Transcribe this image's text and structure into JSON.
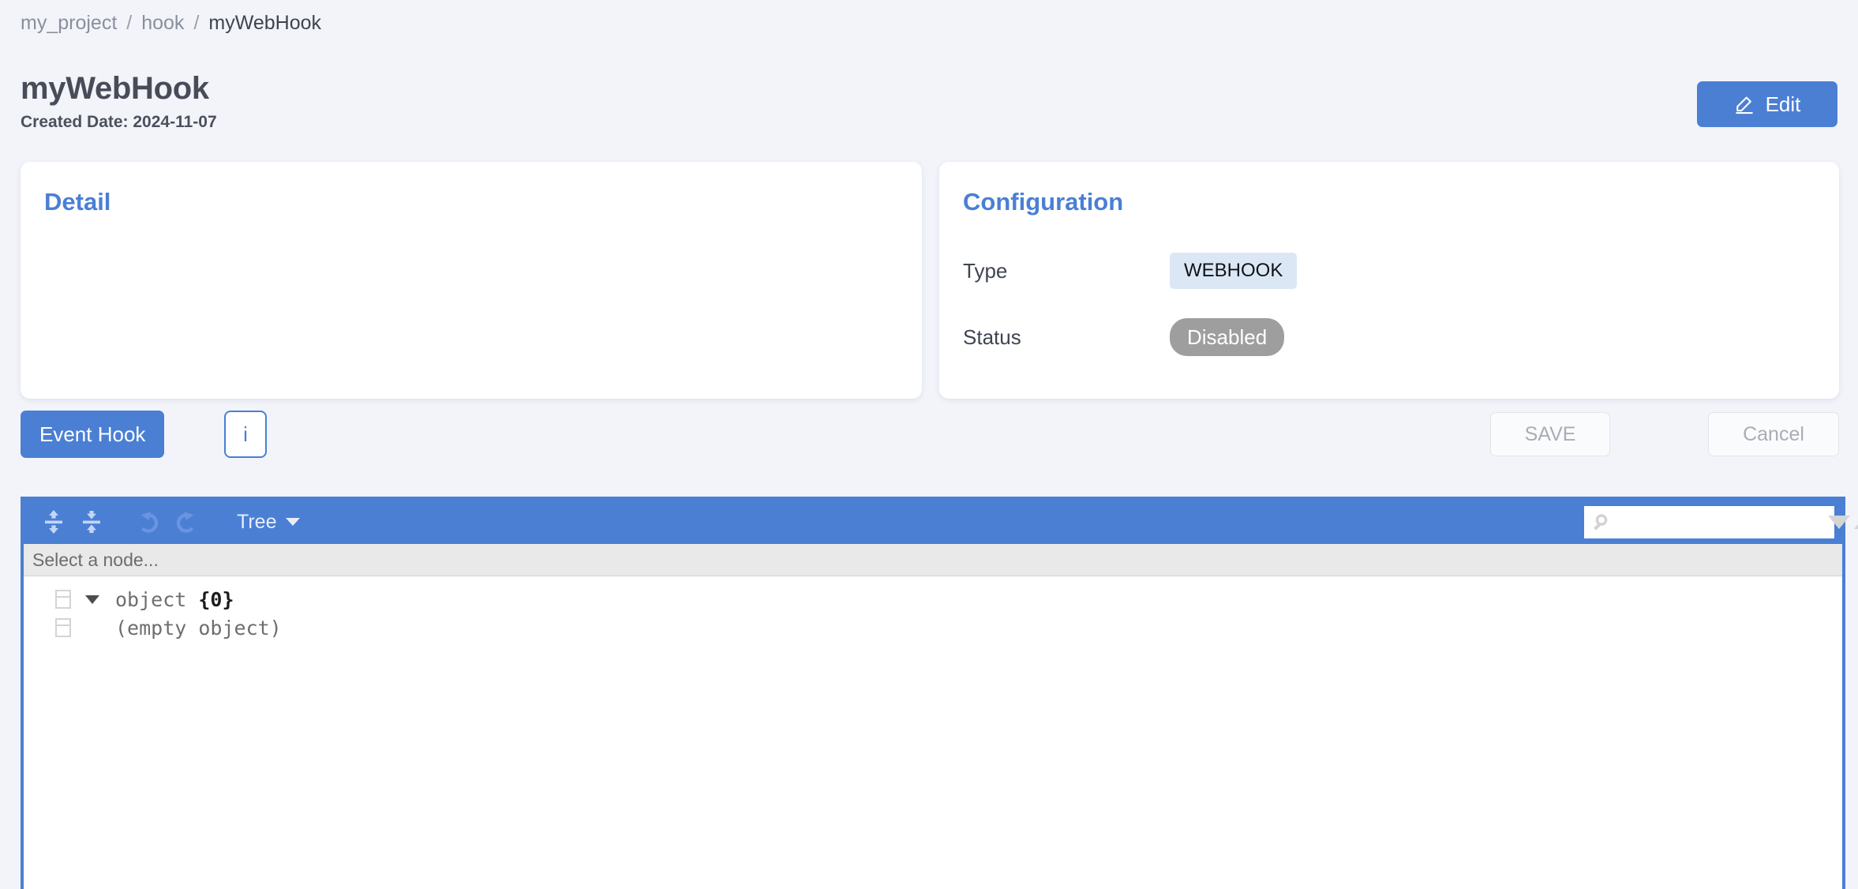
{
  "breadcrumb": {
    "items": [
      "my_project",
      "hook",
      "myWebHook"
    ],
    "separator": "/"
  },
  "header": {
    "title": "myWebHook",
    "created_date": "Created Date: 2024-11-07",
    "edit_button": "Edit",
    "edit_icon": "pencil-icon",
    "accent_color": "#4a7fd4"
  },
  "detail_card": {
    "title": "Detail"
  },
  "configuration_card": {
    "title": "Configuration",
    "rows": [
      {
        "label": "Type",
        "value": "WEBHOOK",
        "chip": "type",
        "chip_bg": "#dbe7f5"
      },
      {
        "label": "Status",
        "value": "Disabled",
        "chip": "status",
        "chip_bg": "#9e9e9e"
      }
    ]
  },
  "action_bar": {
    "event_hook": "Event Hook",
    "info": "i",
    "save": "SAVE",
    "cancel": "Cancel"
  },
  "json_editor": {
    "toolbar": {
      "expand_all_icon": "expand-all-icon",
      "collapse_all_icon": "collapse-all-icon",
      "undo_icon": "undo-icon",
      "redo_icon": "redo-icon",
      "mode_label": "Tree",
      "search_value": "",
      "search_placeholder": ""
    },
    "node_path": "Select a node...",
    "tree": [
      {
        "label": "object ",
        "count": "{0}",
        "expanded": true,
        "has_caret": true
      },
      {
        "label": "(empty object)",
        "count": "",
        "expanded": false,
        "has_caret": false
      }
    ],
    "border_color": "#4a7fd4",
    "toolbar_bg": "#4a7fd4"
  }
}
